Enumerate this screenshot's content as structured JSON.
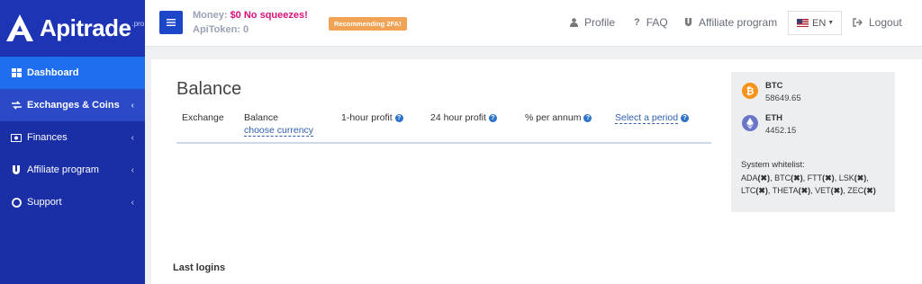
{
  "brand": {
    "name": "Apitrade",
    "suffix": ".pro"
  },
  "sidebar": {
    "items": [
      {
        "label": "Dashboard",
        "icon": "dashboard-icon"
      },
      {
        "label": "Exchanges & Coins",
        "icon": "exchange-icon"
      },
      {
        "label": "Finances",
        "icon": "money-icon"
      },
      {
        "label": "Affiliate program",
        "icon": "magnet-icon"
      },
      {
        "label": "Support",
        "icon": "lifebuoy-icon"
      }
    ]
  },
  "topbar": {
    "money_label": "Money:",
    "money_value": "$0 No squeezes!",
    "apitoken_label": "ApiToken: 0",
    "badge_2fa": "Recommending 2FA!",
    "profile": "Profile",
    "faq": "FAQ",
    "affiliate": "Affiliate program",
    "lang": "EN",
    "logout": "Logout"
  },
  "balance": {
    "title": "Balance",
    "columns": [
      "Exchange",
      "Balance",
      "1-hour profit",
      "24 hour profit",
      "% per annum",
      "Select a period"
    ],
    "choose_currency": "choose currency"
  },
  "coins": [
    {
      "name": "BTC",
      "price": "58649.65",
      "color": "#f7931a"
    },
    {
      "name": "ETH",
      "price": "4452.15",
      "color": "#6b76c9"
    }
  ],
  "whitelist": {
    "title": "System whitelist:",
    "coins": [
      "ADA",
      "BTC",
      "FTT",
      "LSK",
      "LTC",
      "THETA",
      "VET",
      "ZEC"
    ]
  },
  "last_logins": "Last logins"
}
